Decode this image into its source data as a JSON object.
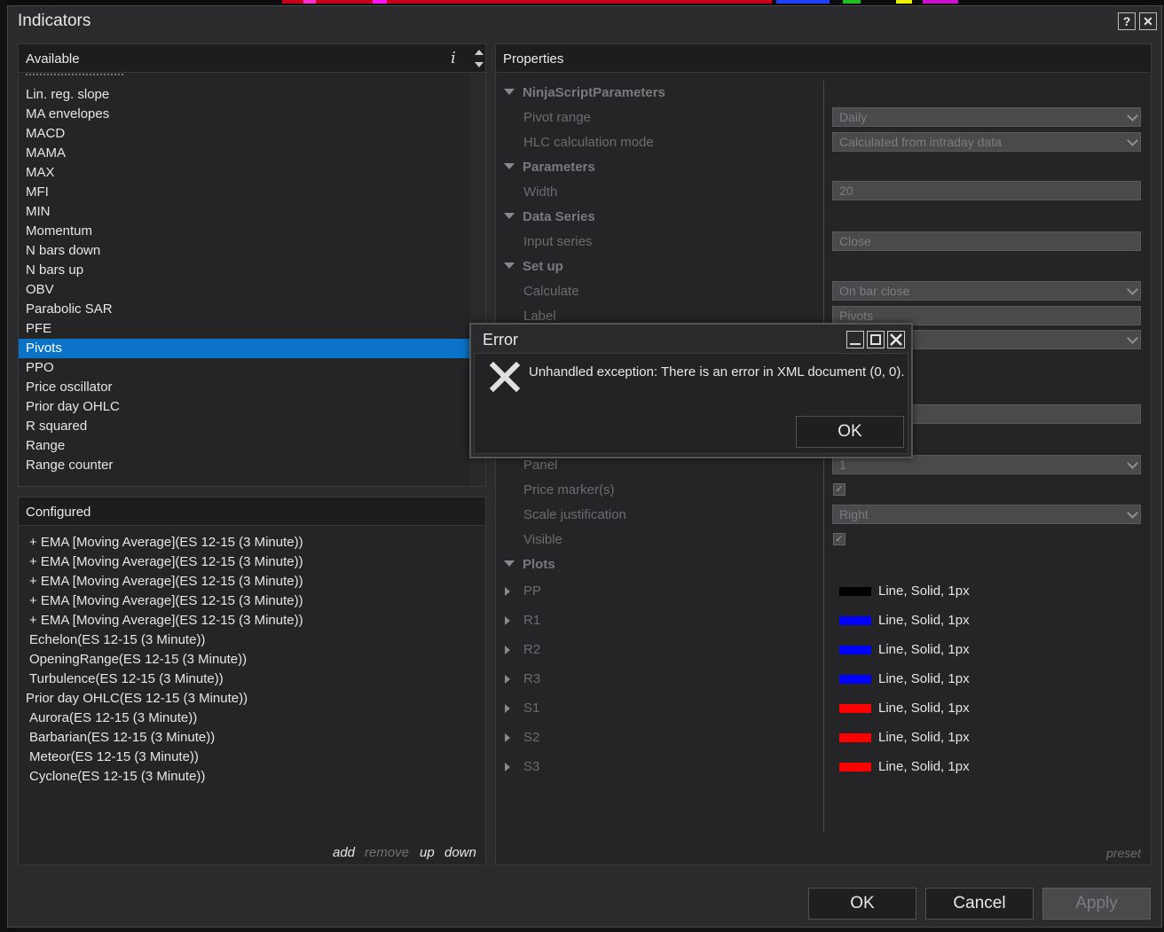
{
  "window": {
    "title": "Indicators",
    "help_button": "?",
    "close_button": "✕"
  },
  "available": {
    "header": "Available",
    "info_icon": "i",
    "items": [
      "Lin. reg. slope",
      "MA envelopes",
      "MACD",
      "MAMA",
      "MAX",
      "MFI",
      "MIN",
      "Momentum",
      "N bars down",
      "N bars up",
      "OBV",
      "Parabolic SAR",
      "PFE",
      "Pivots",
      "PPO",
      "Price oscillator",
      "Prior day OHLC",
      "R squared",
      "Range",
      "Range counter"
    ],
    "selected": "Pivots"
  },
  "configured": {
    "header": "Configured",
    "items": [
      "+ EMA [Moving Average](ES 12-15 (3 Minute))",
      "+ EMA [Moving Average](ES 12-15 (3 Minute))",
      "+ EMA [Moving Average](ES 12-15 (3 Minute))",
      "+ EMA [Moving Average](ES 12-15 (3 Minute))",
      "+ EMA [Moving Average](ES 12-15 (3 Minute))",
      " Echelon(ES 12-15 (3 Minute))",
      " OpeningRange(ES 12-15 (3 Minute))",
      " Turbulence(ES 12-15 (3 Minute))",
      "Prior day OHLC(ES 12-15 (3 Minute))",
      " Aurora(ES 12-15 (3 Minute))",
      " Barbarian(ES 12-15 (3 Minute))",
      " Meteor(ES 12-15 (3 Minute))",
      " Cyclone(ES 12-15 (3 Minute))"
    ],
    "actions": {
      "add": "add",
      "remove": "remove",
      "up": "up",
      "down": "down"
    }
  },
  "properties": {
    "header": "Properties",
    "sections": {
      "ninjascript": "NinjaScriptParameters",
      "parameters": "Parameters",
      "data_series": "Data Series",
      "setup": "Set up",
      "plots": "Plots"
    },
    "rows": {
      "pivot_range": {
        "label": "Pivot range",
        "value": "Daily"
      },
      "hlc_mode": {
        "label": "HLC calculation mode",
        "value": "Calculated from intraday data"
      },
      "width": {
        "label": "Width",
        "value": "20"
      },
      "input_series": {
        "label": "Input series",
        "value": "Close"
      },
      "calculate": {
        "label": "Calculate",
        "value": "On bar close"
      },
      "label": {
        "label": "Label",
        "value": "Pivots"
      },
      "panel": {
        "label": "Panel",
        "value": "1"
      },
      "price_markers": {
        "label": "Price marker(s)",
        "checked": true
      },
      "scale_justification": {
        "label": "Scale justification",
        "value": "Right"
      },
      "visible": {
        "label": "Visible",
        "checked": true
      }
    },
    "plots": [
      {
        "name": "PP",
        "color": "#000000",
        "desc": "Line, Solid, 1px"
      },
      {
        "name": "R1",
        "color": "#0000ff",
        "desc": "Line, Solid, 1px"
      },
      {
        "name": "R2",
        "color": "#0000ff",
        "desc": "Line, Solid, 1px"
      },
      {
        "name": "R3",
        "color": "#0000ff",
        "desc": "Line, Solid, 1px"
      },
      {
        "name": "S1",
        "color": "#ff0000",
        "desc": "Line, Solid, 1px"
      },
      {
        "name": "S2",
        "color": "#ff0000",
        "desc": "Line, Solid, 1px"
      },
      {
        "name": "S3",
        "color": "#ff0000",
        "desc": "Line, Solid, 1px"
      }
    ],
    "preset": "preset"
  },
  "buttons": {
    "ok": "OK",
    "cancel": "Cancel",
    "apply": "Apply"
  },
  "error_dialog": {
    "title": "Error",
    "icon": "close-x-icon",
    "message": "Unhandled exception: There is an error in XML document (0, 0).",
    "ok": "OK"
  },
  "colors": {
    "selection": "#0a73c8",
    "background": "#2b2b2d"
  }
}
